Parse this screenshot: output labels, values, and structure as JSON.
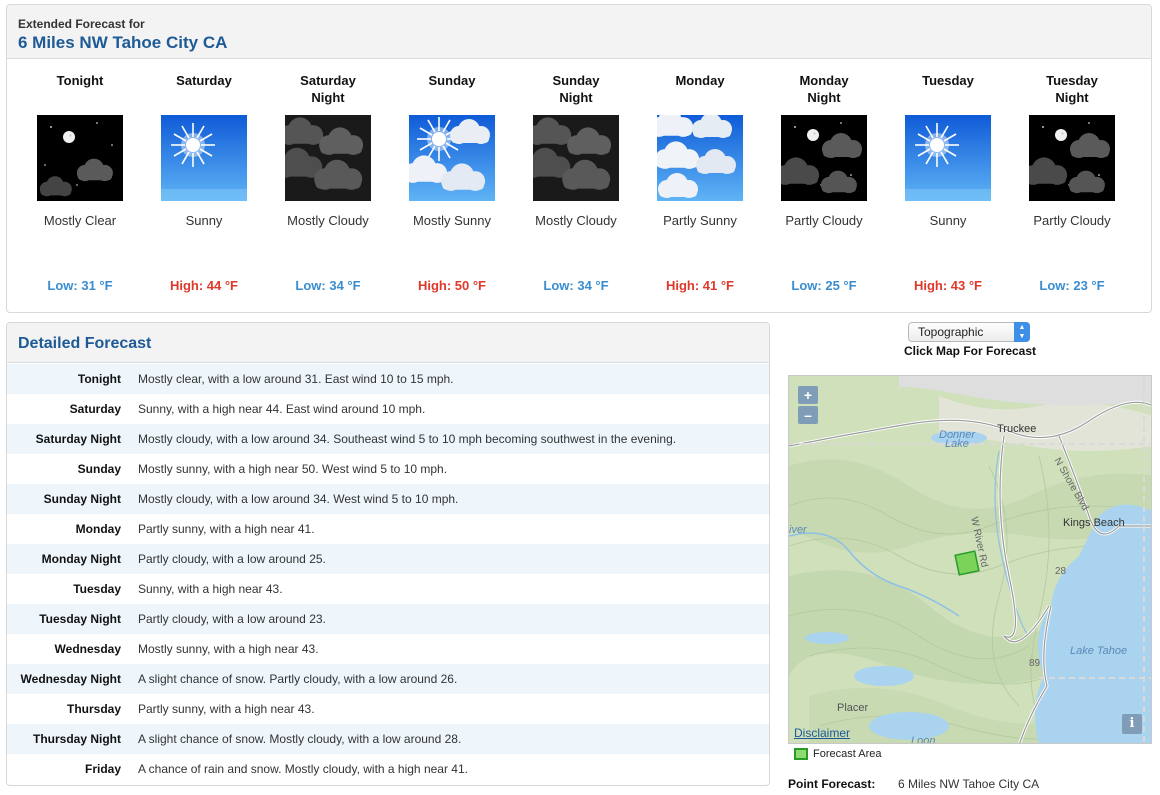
{
  "extended": {
    "label": "Extended Forecast for",
    "location": "6 Miles NW Tahoe City CA",
    "periods": [
      {
        "name": "Tonight",
        "icon": "night-clear-icon",
        "desc": "Mostly Clear",
        "temp": "Low: 31 °F",
        "kind": "low"
      },
      {
        "name": "Saturday",
        "icon": "sunny-icon",
        "desc": "Sunny",
        "temp": "High: 44 °F",
        "kind": "high"
      },
      {
        "name": "Saturday\nNight",
        "icon": "night-cloudy-icon",
        "desc": "Mostly Cloudy",
        "temp": "Low: 34 °F",
        "kind": "low"
      },
      {
        "name": "Sunday",
        "icon": "mostly-sunny-icon",
        "desc": "Mostly Sunny",
        "temp": "High: 50 °F",
        "kind": "high"
      },
      {
        "name": "Sunday\nNight",
        "icon": "night-cloudy-icon",
        "desc": "Mostly Cloudy",
        "temp": "Low: 34 °F",
        "kind": "low"
      },
      {
        "name": "Monday",
        "icon": "partly-sunny-icon",
        "desc": "Partly Sunny",
        "temp": "High: 41 °F",
        "kind": "high"
      },
      {
        "name": "Monday\nNight",
        "icon": "night-partly-cloudy-icon",
        "desc": "Partly Cloudy",
        "temp": "Low: 25 °F",
        "kind": "low"
      },
      {
        "name": "Tuesday",
        "icon": "sunny-icon",
        "desc": "Sunny",
        "temp": "High: 43 °F",
        "kind": "high"
      },
      {
        "name": "Tuesday\nNight",
        "icon": "night-partly-cloudy-icon",
        "desc": "Partly Cloudy",
        "temp": "Low: 23 °F",
        "kind": "low"
      }
    ]
  },
  "detailed": {
    "title": "Detailed Forecast",
    "rows": [
      {
        "label": "Tonight",
        "text": "Mostly clear, with a low around 31. East wind 10 to 15 mph."
      },
      {
        "label": "Saturday",
        "text": "Sunny, with a high near 44. East wind around 10 mph."
      },
      {
        "label": "Saturday Night",
        "text": "Mostly cloudy, with a low around 34. Southeast wind 5 to 10 mph becoming southwest in the evening."
      },
      {
        "label": "Sunday",
        "text": "Mostly sunny, with a high near 50. West wind 5 to 10 mph."
      },
      {
        "label": "Sunday Night",
        "text": "Mostly cloudy, with a low around 34. West wind 5 to 10 mph."
      },
      {
        "label": "Monday",
        "text": "Partly sunny, with a high near 41."
      },
      {
        "label": "Monday Night",
        "text": "Partly cloudy, with a low around 25."
      },
      {
        "label": "Tuesday",
        "text": "Sunny, with a high near 43."
      },
      {
        "label": "Tuesday Night",
        "text": "Partly cloudy, with a low around 23."
      },
      {
        "label": "Wednesday",
        "text": "Mostly sunny, with a high near 43."
      },
      {
        "label": "Wednesday Night",
        "text": "A slight chance of snow. Partly cloudy, with a low around 26."
      },
      {
        "label": "Thursday",
        "text": "Partly sunny, with a high near 43."
      },
      {
        "label": "Thursday Night",
        "text": "A slight chance of snow. Mostly cloudy, with a low around 28."
      },
      {
        "label": "Friday",
        "text": "A chance of rain and snow. Mostly cloudy, with a high near 41."
      }
    ]
  },
  "map": {
    "select_value": "Topographic",
    "caption": "Click Map For Forecast",
    "zoom_in": "+",
    "zoom_out": "–",
    "info": "i",
    "disclaimer": "Disclaimer",
    "labels": {
      "truckee": "Truckee",
      "donner": "Donner",
      "donner_lake": "Lake",
      "kings_beach": "Kings Beach",
      "lake_tahoe": "Lake Tahoe",
      "placer": "Placer",
      "river_rd": "W River Rd",
      "shore_blvd": "N Shore Blvd",
      "river": "iver",
      "loon": "Loon",
      "route_28": "28",
      "route_89": "89"
    },
    "colors": {
      "terrain": "#cfe0bb",
      "lake": "#aad3ef",
      "forecast_area": "#7bd35a"
    }
  },
  "legend": {
    "label": "Forecast Area"
  },
  "point_forecast": {
    "label": "Point Forecast:",
    "value": "6 Miles NW Tahoe City CA"
  }
}
